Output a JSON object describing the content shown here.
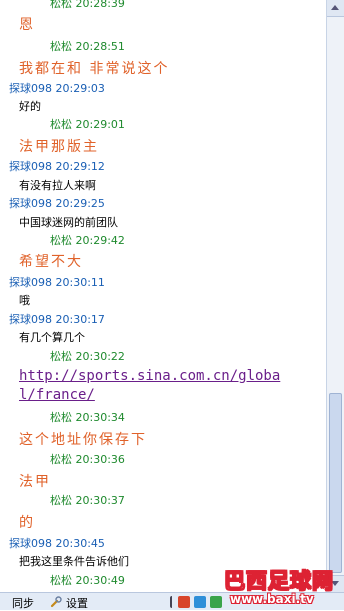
{
  "messages": [
    {
      "sender": "松松",
      "time": "20:28:39",
      "text": "恩",
      "role": "self"
    },
    {
      "sender": "松松",
      "time": "20:28:51",
      "text": "我都在和 非常说这个",
      "role": "self"
    },
    {
      "sender": "探球098",
      "time": "20:29:03",
      "text": "好的",
      "role": "other"
    },
    {
      "sender": "松松",
      "time": "20:29:01",
      "text": "法甲那版主",
      "role": "self"
    },
    {
      "sender": "探球098",
      "time": "20:29:12",
      "text": "有没有拉人来啊",
      "role": "other"
    },
    {
      "sender": "探球098",
      "time": "20:29:25",
      "text": "中国球迷网的前团队",
      "role": "other"
    },
    {
      "sender": "松松",
      "time": "20:29:42",
      "text": "希望不大",
      "role": "self"
    },
    {
      "sender": "探球098",
      "time": "20:30:11",
      "text": "哦",
      "role": "other"
    },
    {
      "sender": "探球098",
      "time": "20:30:17",
      "text": "有几个算几个",
      "role": "other"
    },
    {
      "sender": "松松",
      "time": "20:30:22",
      "text_line1": "http://sports.sina.com.cn/globa",
      "text_line2": "l/france/",
      "role": "self-link"
    },
    {
      "sender": "松松",
      "time": "20:30:34",
      "text": "这个地址你保存下",
      "role": "self"
    },
    {
      "sender": "松松",
      "time": "20:30:36",
      "text": "法甲",
      "role": "self"
    },
    {
      "sender": "松松",
      "time": "20:30:37",
      "text": "的",
      "role": "self"
    },
    {
      "sender": "探球098",
      "time": "20:30:45",
      "text": "把我这里条件告诉他们",
      "role": "other"
    },
    {
      "sender": "松松",
      "time": "20:30:49",
      "text": "",
      "role": "self"
    }
  ],
  "toolbar": {
    "sync_label": "同步",
    "settings_label": "设置"
  },
  "watermark": {
    "title": "巴西足球网",
    "url": "www.baxi.tv"
  },
  "colors": {
    "self_header": "#1f8a2e",
    "other_header": "#1a5fb4",
    "self_text": "#e0622a",
    "link": "#6a1f8a",
    "watermark": "#d22233"
  }
}
